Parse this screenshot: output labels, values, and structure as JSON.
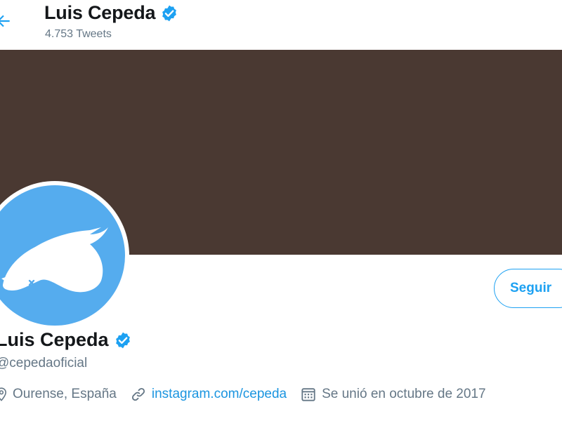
{
  "header": {
    "title": "Luis Cepeda",
    "tweet_count": "4.753 Tweets"
  },
  "profile": {
    "name": "Luis Cepeda",
    "handle": "@cepedaoficial",
    "location": "Ourense, España",
    "website": "instagram.com/cepeda",
    "joined": "Se unió en octubre de 2017"
  },
  "actions": {
    "follow_label": "Seguir"
  },
  "icons": {
    "back": "arrow-left-icon",
    "verified": "verified-badge-icon",
    "location": "location-pin-icon",
    "link": "link-icon",
    "calendar": "calendar-icon"
  },
  "colors": {
    "accent": "#1da1f2",
    "link": "#1b95e0",
    "banner": "#4a3932",
    "avatar_bg": "#55acee",
    "muted_text": "#657786"
  }
}
